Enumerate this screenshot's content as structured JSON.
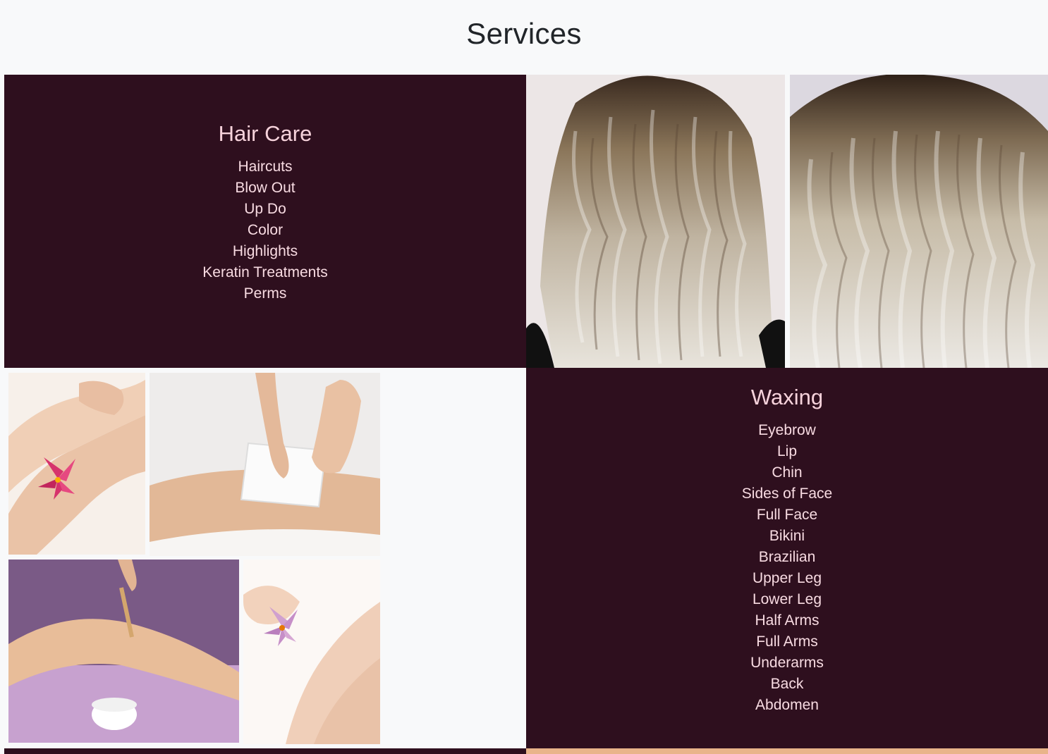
{
  "page": {
    "title": "Services"
  },
  "hair_care": {
    "heading": "Hair Care",
    "items": [
      "Haircuts",
      "Blow Out",
      "Up Do",
      "Color",
      "Highlights",
      "Keratin Treatments",
      "Perms"
    ]
  },
  "waxing": {
    "heading": "Waxing",
    "items": [
      "Eyebrow",
      "Lip",
      "Chin",
      "Sides of Face",
      "Full Face",
      "Bikini",
      "Brazilian",
      "Upper Leg",
      "Lower Leg",
      "Half Arms",
      "Full Arms",
      "Underarms",
      "Back",
      "Abdomen"
    ]
  },
  "colors": {
    "panel_bg": "#2e0f1e",
    "panel_text": "#f8dbe2",
    "page_bg": "#f8f9fa"
  }
}
